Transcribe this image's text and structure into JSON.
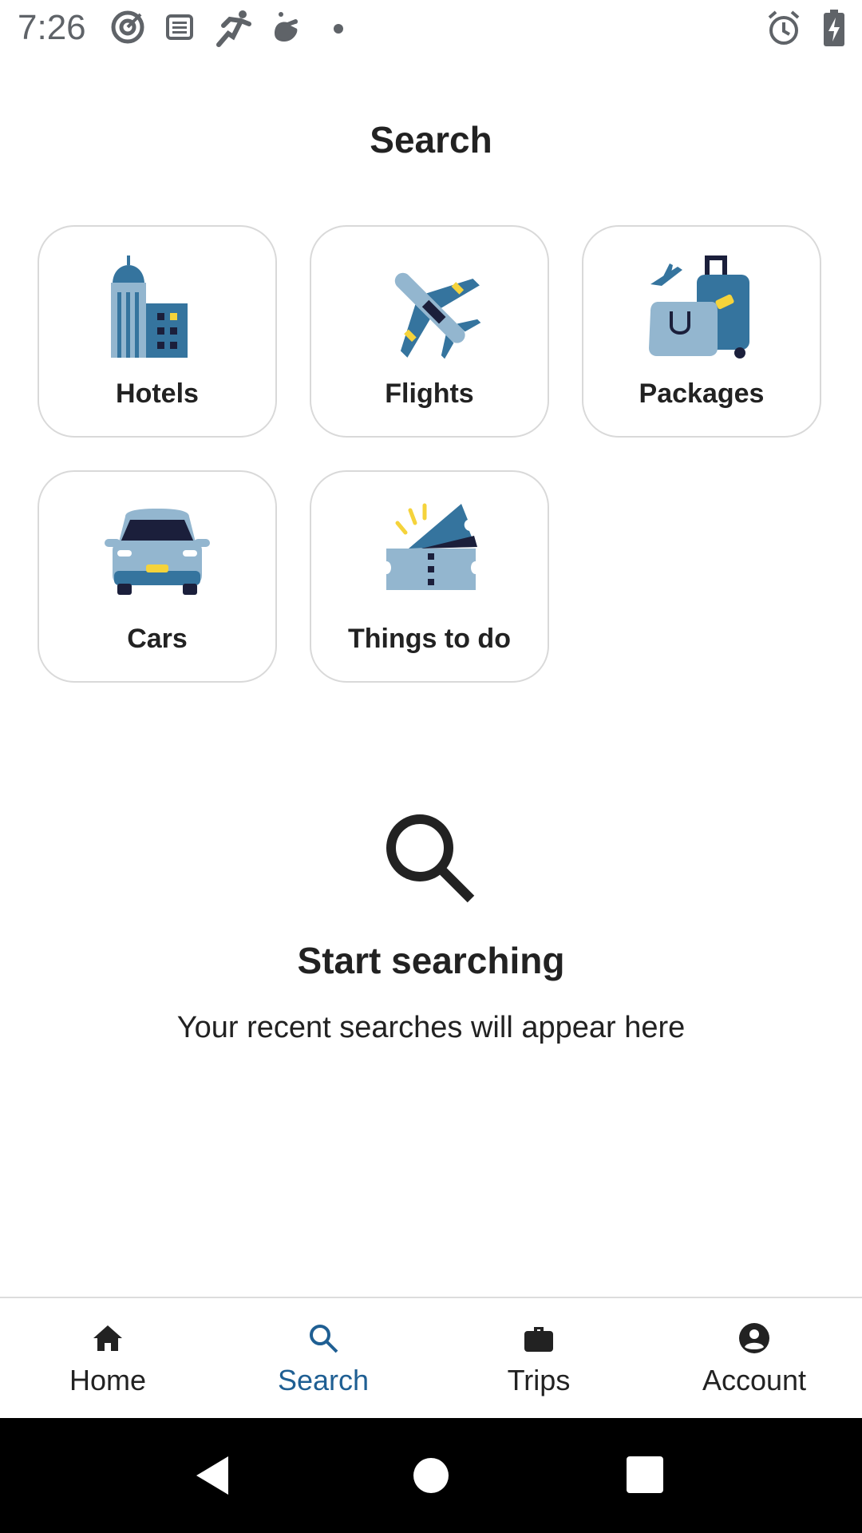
{
  "status_bar": {
    "time": "7:26",
    "left_icons": [
      "target-icon",
      "list-icon",
      "runner-icon",
      "hand-icon",
      "dot-icon"
    ],
    "right_icons": [
      "alarm-icon",
      "battery-charging-icon"
    ]
  },
  "page": {
    "title": "Search"
  },
  "categories": [
    {
      "label": "Hotels",
      "icon": "hotel-building-icon"
    },
    {
      "label": "Flights",
      "icon": "airplane-icon"
    },
    {
      "label": "Packages",
      "icon": "luggage-icon"
    },
    {
      "label": "Cars",
      "icon": "car-icon"
    },
    {
      "label": "Things to do",
      "icon": "ticket-icon"
    }
  ],
  "empty_state": {
    "icon": "search-icon",
    "title": "Start searching",
    "subtitle": "Your recent searches will appear here"
  },
  "bottom_nav": {
    "items": [
      {
        "label": "Home",
        "icon": "home-icon"
      },
      {
        "label": "Search",
        "icon": "search-icon"
      },
      {
        "label": "Trips",
        "icon": "briefcase-icon"
      },
      {
        "label": "Account",
        "icon": "account-circle-icon"
      }
    ],
    "active": "Search",
    "active_color": "#1f5f93"
  },
  "colors": {
    "dark_blue": "#1f3f66",
    "mid_blue": "#35749e",
    "light_blue": "#93b6cf",
    "navy": "#1b1f3b",
    "yellow": "#f5d33b"
  }
}
